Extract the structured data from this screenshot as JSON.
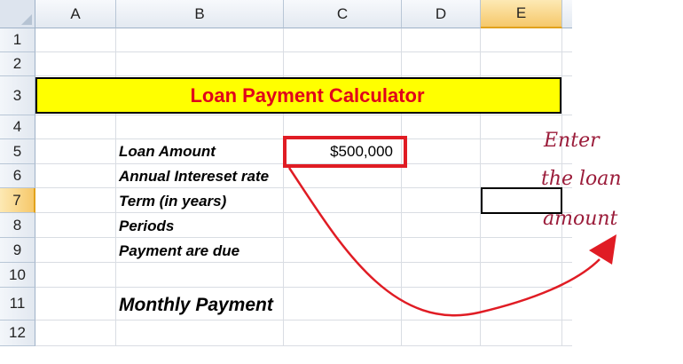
{
  "sheet": {
    "columns": [
      "A",
      "B",
      "C",
      "D",
      "E"
    ],
    "rows": [
      "1",
      "2",
      "3",
      "4",
      "5",
      "6",
      "7",
      "8",
      "9",
      "10",
      "11",
      "12"
    ],
    "selected_column": "E",
    "selected_row": "7"
  },
  "cells": {
    "title": "Loan Payment Calculator",
    "loan_amount_label": "Loan Amount",
    "loan_amount_value": "$500,000",
    "annual_rate_label": "Annual Intereset rate",
    "term_label": "Term (in years)",
    "periods_label": "Periods",
    "payment_due_label": "Payment are due",
    "monthly_payment_label": "Monthly Payment"
  },
  "annotation": {
    "line1": "Enter",
    "line2": "the loan",
    "line3": "amount",
    "color": "#9b1c3a",
    "arrow_color": "#e01c24"
  },
  "colors": {
    "title_bg": "#ffff00",
    "title_text": "#e0001b",
    "highlight_box": "#e01c24",
    "selection_header": "#f6c86a"
  }
}
